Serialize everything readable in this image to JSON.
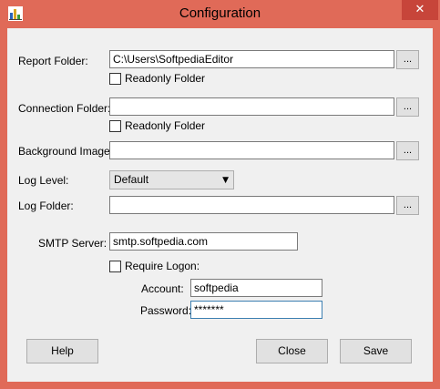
{
  "window": {
    "title": "Configuration",
    "close_glyph": "✕"
  },
  "report_folder": {
    "label": "Report Folder:",
    "value": "C:\\Users\\SoftpediaEditor",
    "browse": "...",
    "readonly_label": "Readonly Folder"
  },
  "connection_folder": {
    "label": "Connection Folder:",
    "value": "",
    "browse": "...",
    "readonly_label": "Readonly Folder"
  },
  "background_image": {
    "label": "Background Image:",
    "value": "",
    "browse": "..."
  },
  "log_level": {
    "label": "Log Level:",
    "value": "Default"
  },
  "log_folder": {
    "label": "Log Folder:",
    "value": "",
    "browse": "..."
  },
  "smtp": {
    "server_label": "SMTP Server:",
    "server_value": "smtp.softpedia.com",
    "require_logon_label": "Require Logon:",
    "account_label": "Account:",
    "account_value": "softpedia",
    "password_label": "Password:",
    "password_value": "*******"
  },
  "buttons": {
    "help": "Help",
    "close": "Close",
    "save": "Save"
  },
  "colors": {
    "frame": "#e06a58",
    "client": "#f0f0f0",
    "close_button": "#c7453a"
  }
}
